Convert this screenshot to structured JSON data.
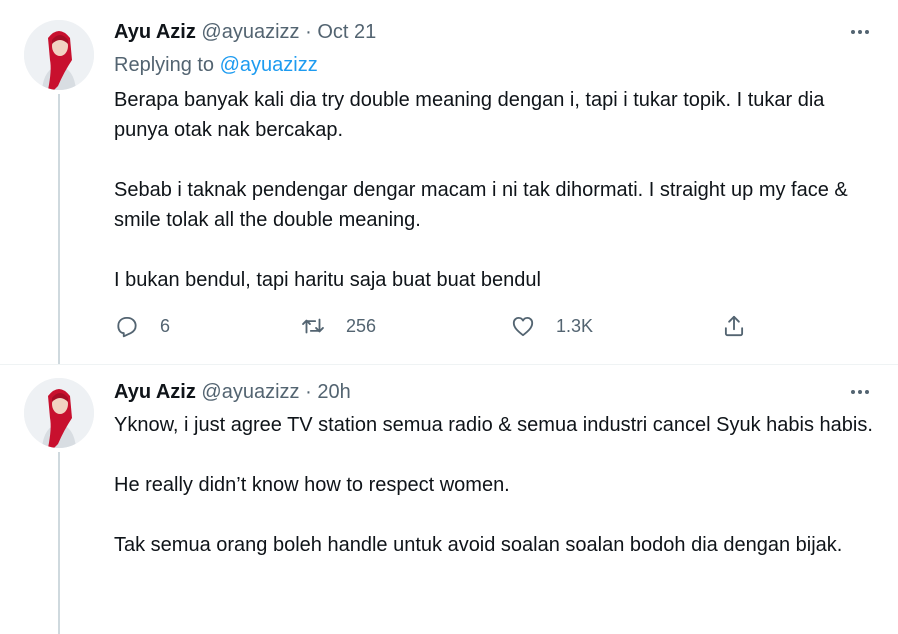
{
  "tweets": [
    {
      "name": "Ayu Aziz",
      "handle": "@ayuazizz",
      "separator": "·",
      "time": "Oct 21",
      "replying_prefix": "Replying to",
      "replying_to": "@ayuazizz",
      "paragraphs": [
        "Berapa banyak kali dia try double meaning dengan i, tapi i tukar topik. I tukar dia punya otak nak bercakap.",
        "Sebab i taknak pendengar dengar macam i ni tak dihormati. I straight up my face & smile tolak all the double meaning.",
        "I bukan bendul, tapi haritu saja buat buat bendul"
      ],
      "actions": {
        "reply_icon": "reply-icon",
        "reply_count": "6",
        "retweet_icon": "retweet-icon",
        "retweet_count": "256",
        "like_icon": "heart-icon",
        "like_count": "1.3K",
        "share_icon": "share-icon"
      }
    },
    {
      "name": "Ayu Aziz",
      "handle": "@ayuazizz",
      "separator": "·",
      "time": "20h",
      "paragraphs": [
        "Yknow, i just agree TV station semua radio & semua industri cancel Syuk habis habis.",
        "He really didn’t know how to respect women.",
        "Tak semua orang boleh handle untuk avoid soalan soalan bodoh dia dengan bijak."
      ]
    }
  ],
  "colors": {
    "text": "#0f1419",
    "secondary": "#536471",
    "link": "#1d9bf0",
    "divider": "#eff3f4",
    "thread_line": "#cfd9de"
  }
}
